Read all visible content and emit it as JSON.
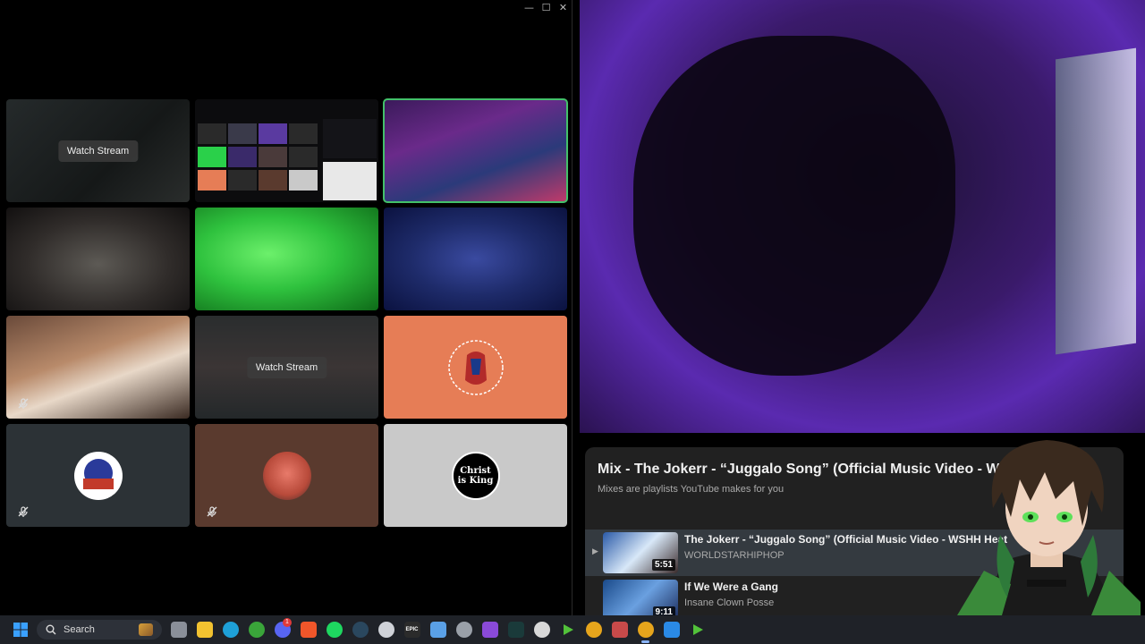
{
  "call_window": {
    "controls": {
      "minimize": "—",
      "maximize": "☐",
      "close": "✕"
    },
    "tiles": [
      {
        "name": "tile-stream-1",
        "type": "stream",
        "button_label": "Watch Stream",
        "bg": "bg-dim"
      },
      {
        "name": "tile-screen-share",
        "type": "screen",
        "bg": "bg-screen"
      },
      {
        "name": "tile-participant-bearded",
        "type": "video",
        "bg": "bg-purple",
        "speaking": true
      },
      {
        "name": "tile-participant-headphones",
        "type": "video",
        "bg": "bg-room"
      },
      {
        "name": "tile-participant-green",
        "type": "video",
        "bg": "bg-green"
      },
      {
        "name": "tile-participant-beanie",
        "type": "video",
        "bg": "bg-blue"
      },
      {
        "name": "tile-participant-couch",
        "type": "video",
        "bg": "bg-couch",
        "muted": true
      },
      {
        "name": "tile-stream-2",
        "type": "stream",
        "button_label": "Watch Stream",
        "bg": "bg-fog"
      },
      {
        "name": "tile-avatar-spider",
        "type": "avatar",
        "bg": "bg-orange"
      },
      {
        "name": "tile-avatar-logo",
        "type": "avatar",
        "bg": "bg-slate",
        "muted": true
      },
      {
        "name": "tile-avatar-face",
        "type": "avatar",
        "bg": "bg-brown",
        "muted": true
      },
      {
        "name": "tile-avatar-christ",
        "type": "avatar",
        "bg": "bg-grey",
        "avatar_text": "Christ is King"
      }
    ]
  },
  "playlist": {
    "title": "Mix - The Jokerr - “Juggalo Song” (Official Music Video - WS",
    "subtitle": "Mixes are playlists YouTube makes for you",
    "items": [
      {
        "title": "The Jokerr - “Juggalo Song” (Official Music Video - WSHH Heat",
        "channel": "WORLDSTARHIPHOP",
        "duration": "5:51",
        "active": true
      },
      {
        "title": "If We Were a Gang",
        "channel": "Insane Clown Posse",
        "duration": "9:11",
        "active": false
      }
    ]
  },
  "taskbar": {
    "search_label": "Search",
    "discord_badge": "1",
    "epic_label": "EPIC",
    "icons": [
      {
        "name": "windows-start-icon",
        "color": "#3aa0ff"
      },
      {
        "name": "task-view-icon",
        "color": "#8a8f99"
      },
      {
        "name": "file-explorer-icon",
        "color": "#f2c230"
      },
      {
        "name": "edge-browser-icon",
        "color": "#1ea0d8"
      },
      {
        "name": "xbox-icon",
        "color": "#3aa53a"
      },
      {
        "name": "discord-icon",
        "color": "#5865f2"
      },
      {
        "name": "brave-browser-icon",
        "color": "#f0562a"
      },
      {
        "name": "spotify-icon",
        "color": "#1ed760"
      },
      {
        "name": "steam-icon",
        "color": "#2a475e"
      },
      {
        "name": "obs-icon",
        "color": "#cfd2d8"
      },
      {
        "name": "epic-games-icon",
        "color": "#2b2b2b"
      },
      {
        "name": "notepad-icon",
        "color": "#5aa0e6"
      },
      {
        "name": "chatgpt-icon",
        "color": "#9aa0a8"
      },
      {
        "name": "video-editor-icon",
        "color": "#8a4ad8"
      },
      {
        "name": "terminal-icon",
        "color": "#1a3a3a"
      },
      {
        "name": "settings-gear-icon",
        "color": "#d8d8d8"
      },
      {
        "name": "media-player-icon",
        "color": "#52c23a"
      },
      {
        "name": "chrome-icon",
        "color": "#e6a51c"
      },
      {
        "name": "app-m-icon",
        "color": "#c84a4a"
      },
      {
        "name": "chrome-active-icon",
        "color": "#e6a51c"
      },
      {
        "name": "photos-icon",
        "color": "#2a8ae6"
      },
      {
        "name": "media-player-2-icon",
        "color": "#52c23a"
      }
    ]
  }
}
